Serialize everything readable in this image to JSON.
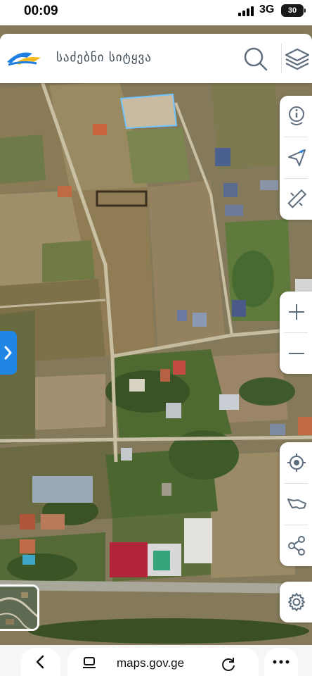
{
  "status_bar": {
    "time": "00:09",
    "network": "3G",
    "battery": "30"
  },
  "header": {
    "title": "საძებნი სიტყვა",
    "logo_icon": "logo-icon",
    "search_icon": "search-icon",
    "layers_icon": "layers-icon"
  },
  "tools_top": [
    "info-icon",
    "navigate-icon",
    "measure-icon"
  ],
  "zoom": [
    "zoom-in-icon",
    "zoom-out-icon"
  ],
  "tools_bottom": [
    "locate-icon",
    "country-map-icon",
    "share-icon"
  ],
  "settings_icon": "gear-icon",
  "side_toggle_icon": "chevron-right-icon",
  "browser": {
    "url": "maps.gov.ge",
    "back_icon": "chevron-left-icon",
    "tabs_icon": "tabs-icon",
    "reload_icon": "reload-icon",
    "more_icon": "more-icon"
  },
  "colors": {
    "accent": "#1f86e6",
    "icon": "#5d6d7e",
    "title_text": "#3f4a57",
    "logo_blue": "#1f7fe0",
    "logo_yellow": "#f4b820"
  }
}
